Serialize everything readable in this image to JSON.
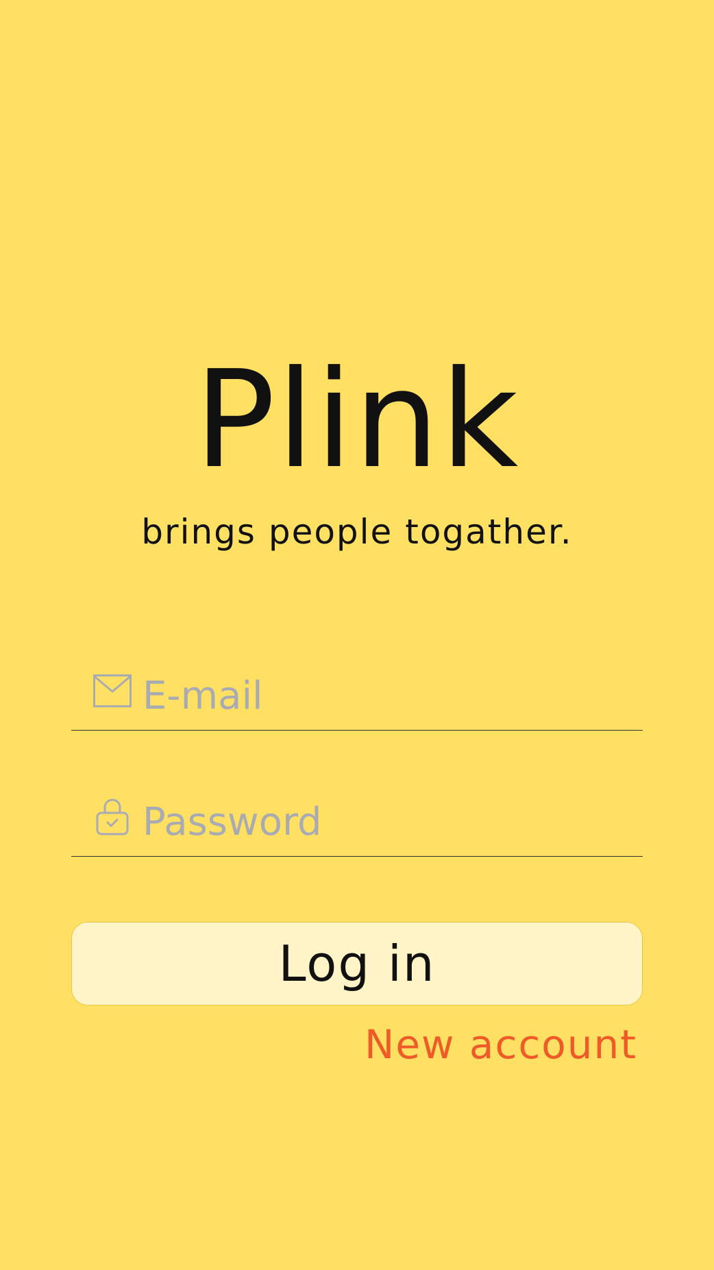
{
  "app": {
    "name": "Plink",
    "tagline": "brings people togather."
  },
  "login_form": {
    "email": {
      "placeholder": "E-mail",
      "value": "",
      "icon": "envelope-icon"
    },
    "password": {
      "placeholder": "Password",
      "value": "",
      "icon": "lock-icon"
    },
    "login_label": "Log in",
    "new_account_label": "New account"
  },
  "colors": {
    "background": "#FFE062",
    "button_fill": "#FFF4C8",
    "accent": "#F05A28",
    "placeholder": "#A9ABB2"
  }
}
